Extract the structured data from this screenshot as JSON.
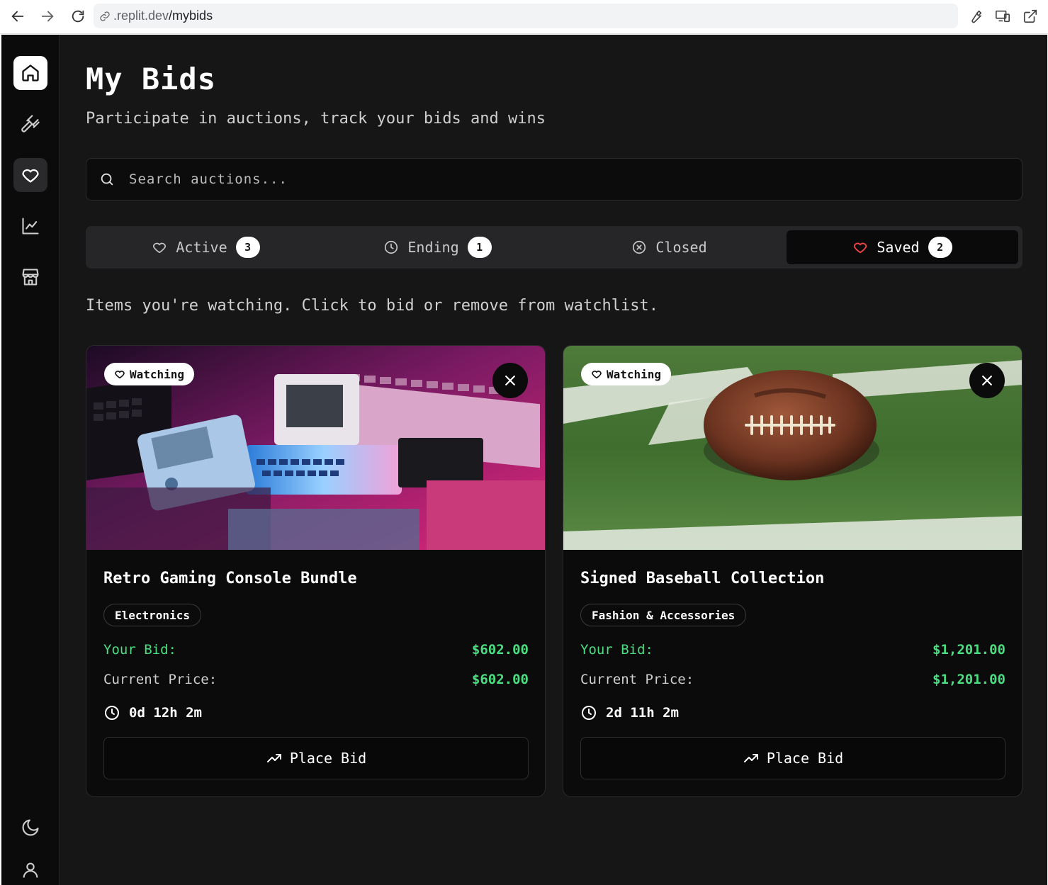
{
  "browser": {
    "url_prefix": ".replit.dev",
    "url_path": "/mybids"
  },
  "page": {
    "title": "My Bids",
    "subtitle": "Participate in auctions, track your bids and wins"
  },
  "search": {
    "placeholder": "Search auctions..."
  },
  "tabs": [
    {
      "label": "Active",
      "count": "3",
      "icon": "heart-icon"
    },
    {
      "label": "Ending",
      "count": "1",
      "icon": "clock-icon"
    },
    {
      "label": "Closed",
      "count": "",
      "icon": "x-circle-icon"
    },
    {
      "label": "Saved",
      "count": "2",
      "icon": "heart-icon",
      "selected": true
    }
  ],
  "hint": "Items you're watching. Click to bid or remove from watchlist.",
  "cards": [
    {
      "badge": "Watching",
      "title": "Retro Gaming Console Bundle",
      "category": "Electronics",
      "your_bid_label": "Your Bid:",
      "your_bid": "$602.00",
      "current_label": "Current Price:",
      "current": "$602.00",
      "time_left": "0d 12h 2m",
      "button": "Place Bid"
    },
    {
      "badge": "Watching",
      "title": "Signed Baseball Collection",
      "category": "Fashion & Accessories",
      "your_bid_label": "Your Bid:",
      "your_bid": "$1,201.00",
      "current_label": "Current Price:",
      "current": "$1,201.00",
      "time_left": "2d 11h 2m",
      "button": "Place Bid"
    }
  ],
  "colors": {
    "accent_green": "#4ade80",
    "saved_heart": "#ef4444",
    "background": "#161616"
  }
}
